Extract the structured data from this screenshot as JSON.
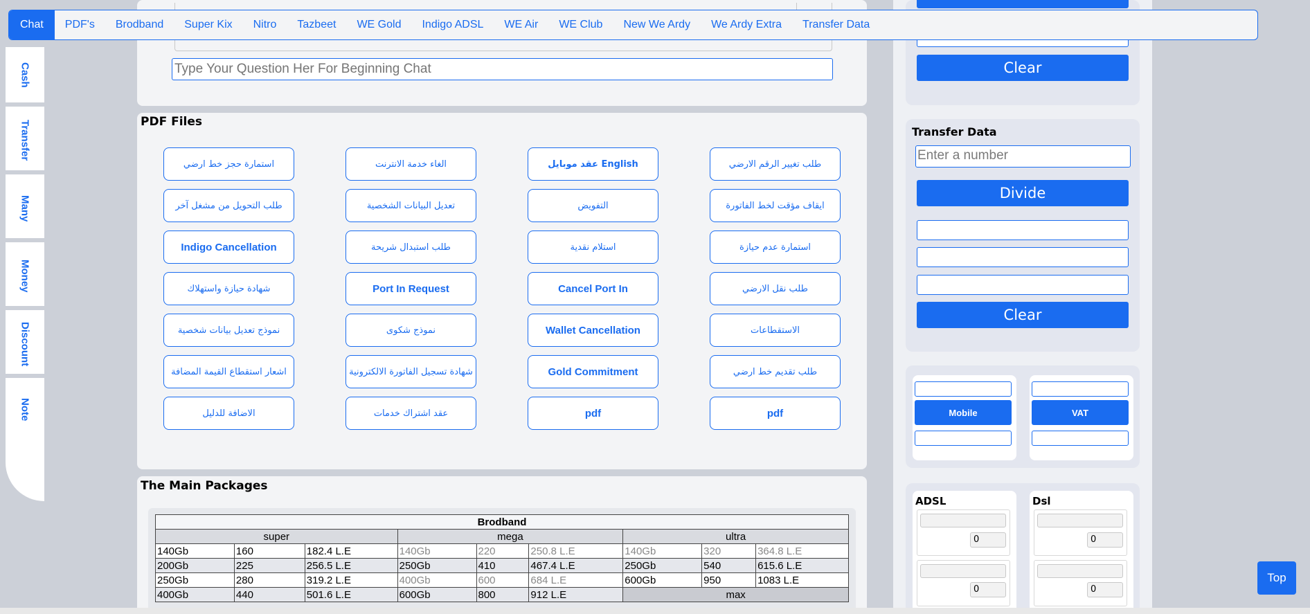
{
  "nav": {
    "tabs": [
      "Chat",
      "PDF's",
      "Brodband",
      "Super Kix",
      "Nitro",
      "Tazbeet",
      "WE Gold",
      "Indigo ADSL",
      "WE Air",
      "WE Club",
      "New We Ardy",
      "We Ardy Extra",
      "Transfer Data"
    ],
    "active": "Chat"
  },
  "side": {
    "tabs": [
      "Cash",
      "Transfer",
      "Many",
      "Money",
      "Discount",
      "Note"
    ]
  },
  "chat": {
    "placeholder": "Type Your Question Her For Beginning Chat"
  },
  "pdf": {
    "title": "PDF Files",
    "rows": [
      [
        "استمارة حجز خط ارضي",
        "الغاء خدمة الانترنت",
        "عقد موبايل English",
        "طلب تغيير الرقم الارضي"
      ],
      [
        "طلب التحويل من مشغل آخر",
        "تعديل البيانات الشخصية",
        "التفويض",
        "ايقاف مؤقت لخط الفاتورة"
      ],
      [
        "Indigo Cancellation",
        "طلب استبدال شريحة",
        "استلام نقدية",
        "استمارة عدم حيازة"
      ],
      [
        "شهادة حيازة واستهلاك",
        "Port In Request",
        "Cancel Port In",
        "طلب نقل الارضي"
      ],
      [
        "نموذج تعديل بيانات شخصية",
        "نموذج شكوى",
        "Wallet Cancellation",
        "الاستقطاعات"
      ],
      [
        "اشعار استقطاع القيمة المضافة",
        "شهادة تسجيل الفاتورة الالكترونية",
        "Gold Commitment",
        "طلب تقديم خط ارضي"
      ],
      [
        "الاضافة للدليل",
        "عقد اشتراك خدمات",
        "pdf",
        "pdf"
      ]
    ]
  },
  "packages": {
    "title": "The Main Packages",
    "table_title": "Brodband",
    "groups": [
      "super",
      "mega",
      "ultra"
    ],
    "rows": [
      [
        "140Gb",
        "160",
        "182.4 L.E",
        "140Gb",
        "220",
        "250.8 L.E",
        "140Gb",
        "320",
        "364.8 L.E"
      ],
      [
        "200Gb",
        "225",
        "256.5 L.E",
        "250Gb",
        "410",
        "467.4 L.E",
        "250Gb",
        "540",
        "615.6 L.E"
      ],
      [
        "250Gb",
        "280",
        "319.2 L.E",
        "400Gb",
        "600",
        "684 L.E",
        "600Gb",
        "950",
        "1083 L.E"
      ],
      [
        "400Gb",
        "440",
        "501.6 L.E",
        "600Gb",
        "800",
        "912 L.E"
      ]
    ],
    "max_label": "max"
  },
  "right": {
    "clear_top": "Clear",
    "transfer_title": "Transfer Data",
    "transfer_placeholder": "Enter a number",
    "divide": "Divide",
    "clear": "Clear",
    "mobile": "Mobile",
    "vat": "VAT",
    "adsl_title": "ADSL",
    "dsl_title": "Dsl",
    "adsl_values": [
      "0",
      "0"
    ],
    "dsl_values": [
      "0",
      "0"
    ]
  },
  "top_button": "Top",
  "colors": {
    "accent": "#1a6cf0",
    "panel": "#f3f4f6",
    "background": "#ccd0d8"
  }
}
